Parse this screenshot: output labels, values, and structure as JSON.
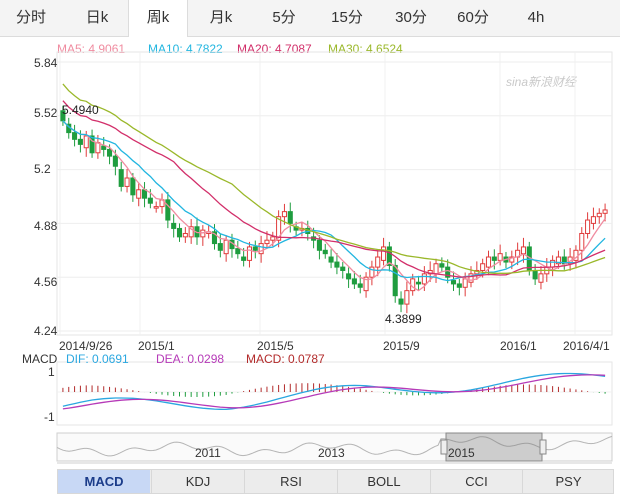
{
  "tabs": [
    "分时",
    "日k",
    "周k",
    "月k",
    "5分",
    "15分",
    "30分",
    "60分",
    "4h"
  ],
  "active_tab": "周k",
  "legend": {
    "ma5": "MA5: 4.9061",
    "ma10": "MA10: 4.7822",
    "ma20": "MA20: 4.7087",
    "ma30": "MA30: 4.6524"
  },
  "watermark": "sina新浪财经",
  "colors": {
    "up": "#e03c3c",
    "down": "#1f9d3f",
    "ma5": "#f08ca0",
    "ma10": "#22b6e0",
    "ma20": "#d22f6a",
    "ma30": "#9ab82a",
    "dif": "#2aa7e0",
    "dea": "#b63ab8",
    "macd": "#b22a2a"
  },
  "price_axis": {
    "ticks": [
      "5.84",
      "5.52",
      "5.2",
      "4.88",
      "4.56",
      "4.24"
    ]
  },
  "time_axis": {
    "ticks": [
      "2014/9/26",
      "2015/1",
      "2015/5",
      "2015/9",
      "2016/1",
      "2016/4/1"
    ]
  },
  "annotations": {
    "high": "5.4940",
    "low": "4.3899"
  },
  "macd_header": {
    "label": "MACD",
    "dif": "DIF: 0.0691",
    "dea": "DEA: 0.0298",
    "macd": "MACD: 0.0787"
  },
  "macd_axis": {
    "top": "1",
    "bottom": "-1"
  },
  "navigator": {
    "ticks": [
      "2011",
      "2013",
      "2015"
    ]
  },
  "indicator_tabs": [
    "MACD",
    "KDJ",
    "RSI",
    "BOLL",
    "CCI",
    "PSY"
  ],
  "active_indicator": "MACD",
  "chart_data": {
    "type": "candlestick",
    "ylim": [
      4.24,
      5.84
    ],
    "annotations": [
      "5.4940",
      "4.3899"
    ],
    "closes": [
      5.49,
      5.42,
      5.38,
      5.35,
      5.4,
      5.3,
      5.36,
      5.32,
      5.28,
      5.22,
      5.1,
      5.15,
      5.05,
      5.08,
      5.03,
      5.0,
      4.98,
      5.02,
      4.9,
      4.85,
      4.8,
      4.82,
      4.86,
      4.8,
      4.84,
      4.83,
      4.76,
      4.72,
      4.78,
      4.73,
      4.7,
      4.66,
      4.74,
      4.72,
      4.76,
      4.78,
      4.8,
      4.92,
      4.95,
      4.88,
      4.84,
      4.85,
      4.82,
      4.78,
      4.72,
      4.7,
      4.65,
      4.62,
      4.6,
      4.55,
      4.52,
      4.5,
      4.56,
      4.62,
      4.68,
      4.74,
      4.63,
      4.45,
      4.4,
      4.48,
      4.55,
      4.52,
      4.58,
      4.6,
      4.64,
      4.62,
      4.56,
      4.52,
      4.5,
      4.55,
      4.58,
      4.6,
      4.64,
      4.68,
      4.66,
      4.7,
      4.65,
      4.68,
      4.72,
      4.74,
      4.6,
      4.55,
      4.58,
      4.62,
      4.66,
      4.68,
      4.64,
      4.68,
      4.72,
      4.82,
      4.9,
      4.92,
      4.94,
      4.96
    ],
    "macd_series": {
      "names": [
        "DIF",
        "DEA",
        "MACD"
      ],
      "range": [
        -1,
        1
      ]
    }
  }
}
